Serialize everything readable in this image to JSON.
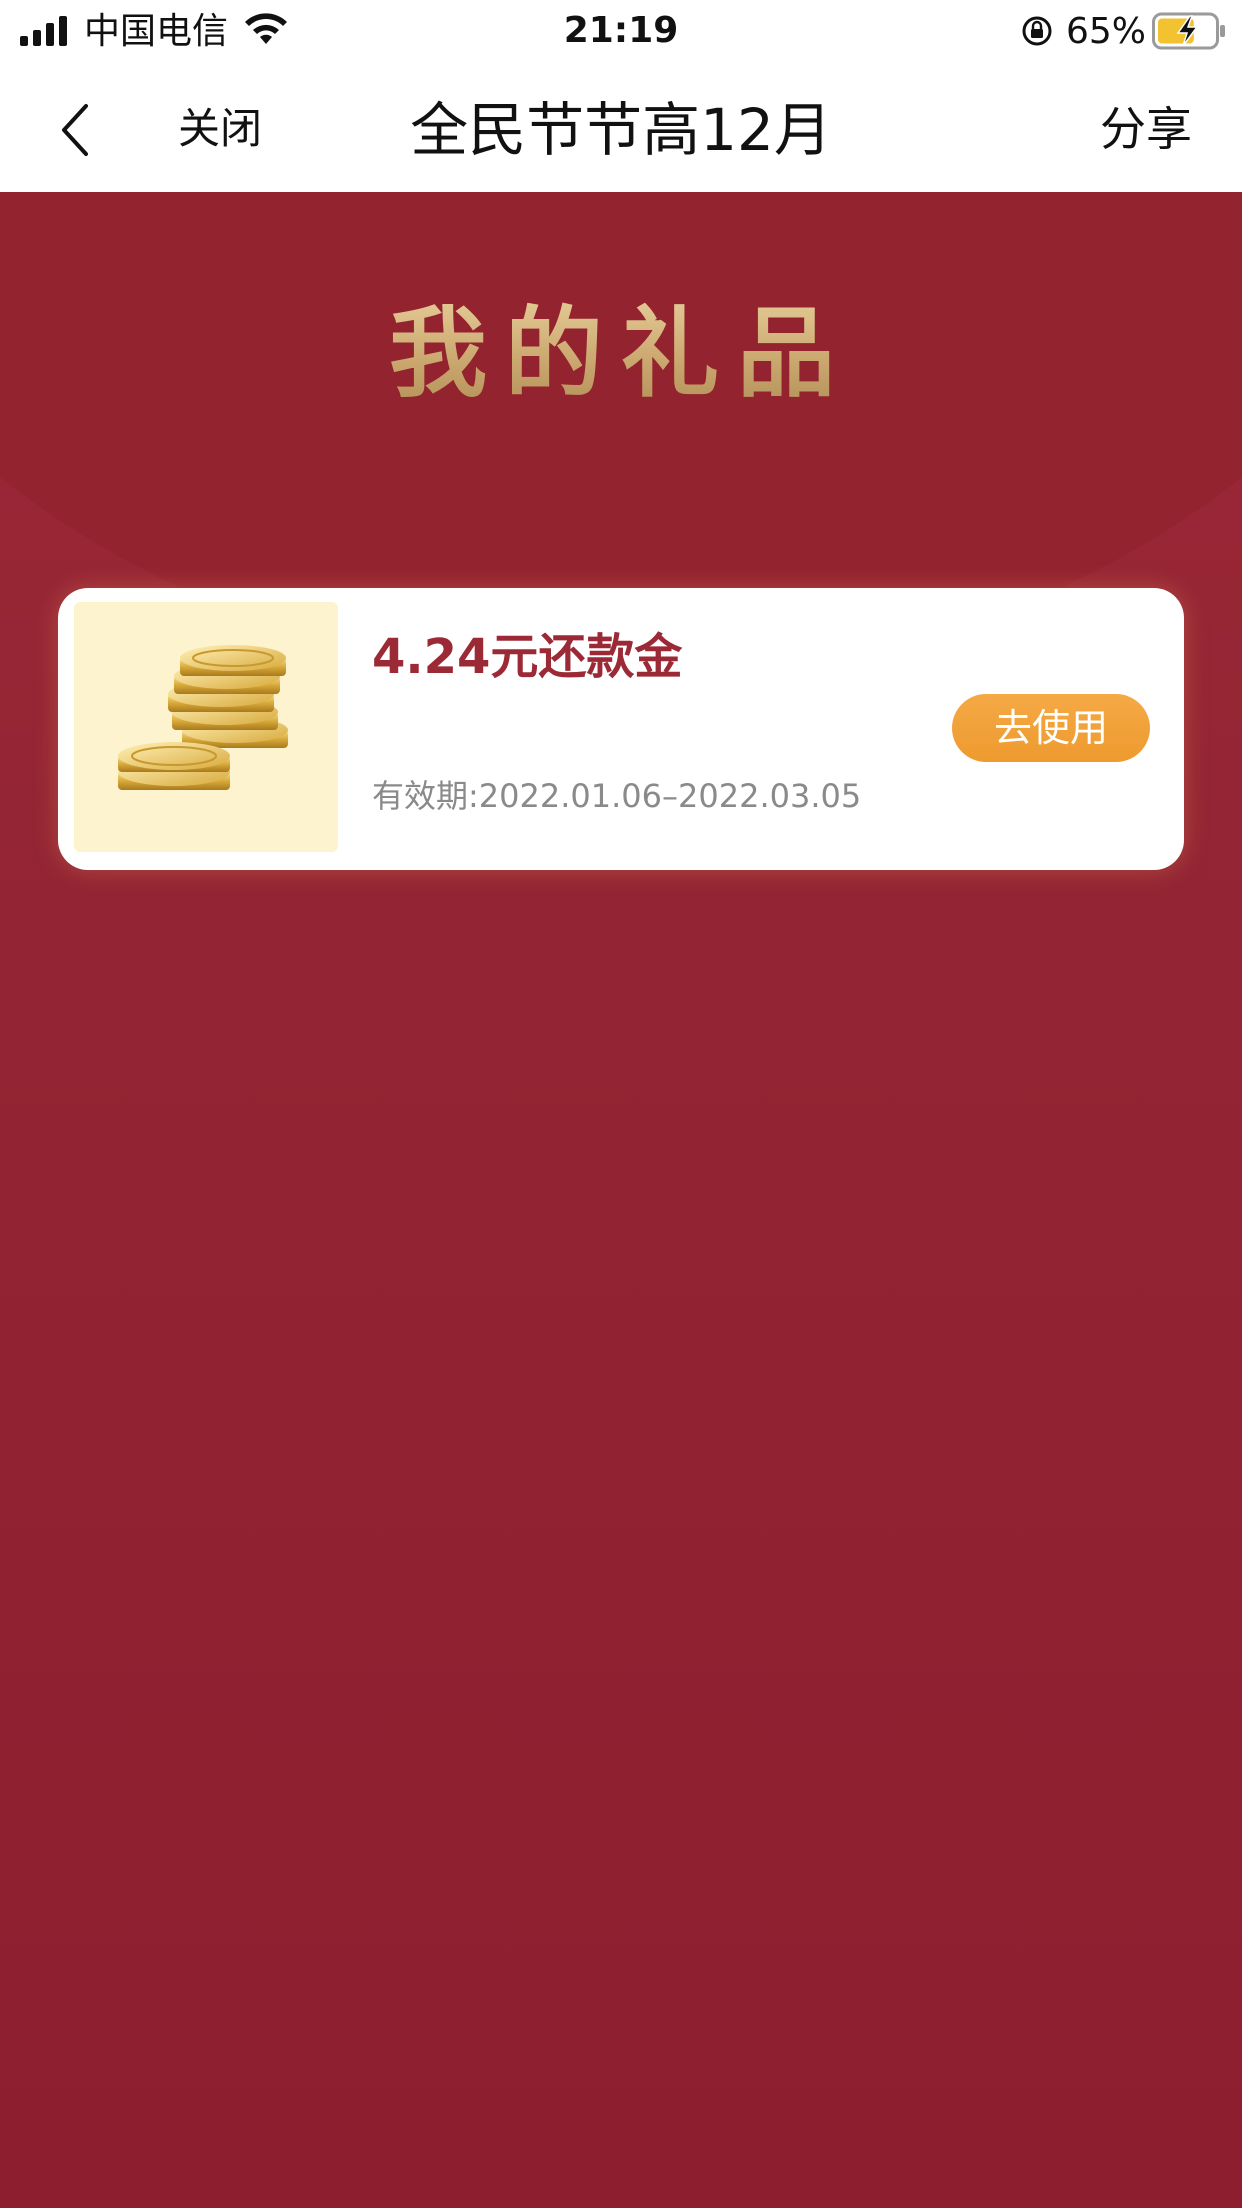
{
  "status_bar": {
    "carrier": "中国电信",
    "time": "21:19",
    "battery_percent": "65%",
    "battery_level": 0.65
  },
  "nav": {
    "close_label": "关闭",
    "title": "全民节节高12月",
    "share_label": "分享"
  },
  "page": {
    "header_title": "我的礼品"
  },
  "gifts": [
    {
      "name": "4.24元还款金",
      "validity": "有效期:2022.01.06–2022.03.05",
      "action_label": "去使用",
      "icon": "gold-coins-icon"
    }
  ],
  "colors": {
    "background": "#8e1f30",
    "accent_gold": "#d6b884",
    "price_red": "#9b2a36",
    "button_orange": "#f0a03a"
  }
}
